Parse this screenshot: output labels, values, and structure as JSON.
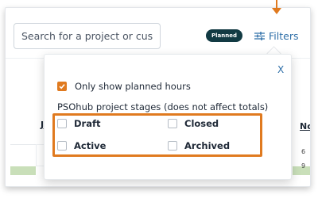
{
  "header": {
    "search_placeholder": "Search for a project or customer...",
    "planned_badge": "Planned",
    "filters_label": "Filters"
  },
  "background_table": {
    "left_header": "J",
    "right_header": "No",
    "right_values": [
      "6",
      "9"
    ]
  },
  "filter_popup": {
    "close_label": "X",
    "only_planned_label": "Only show planned hours",
    "only_planned_checked": true,
    "stages_title": "PSOhub project stages (does not affect totals)",
    "stages": [
      {
        "label": "Draft",
        "checked": false
      },
      {
        "label": "Closed",
        "checked": false
      },
      {
        "label": "Active",
        "checked": false
      },
      {
        "label": "Archived",
        "checked": false
      }
    ]
  },
  "colors": {
    "accent_orange": "#e07a1f",
    "link_blue": "#2f6fa8",
    "badge_dark": "#123a43",
    "row_green": "#c9dfb9"
  },
  "icons": [
    "filter-sliders-icon",
    "checkmark-icon",
    "down-arrow-annotation"
  ]
}
